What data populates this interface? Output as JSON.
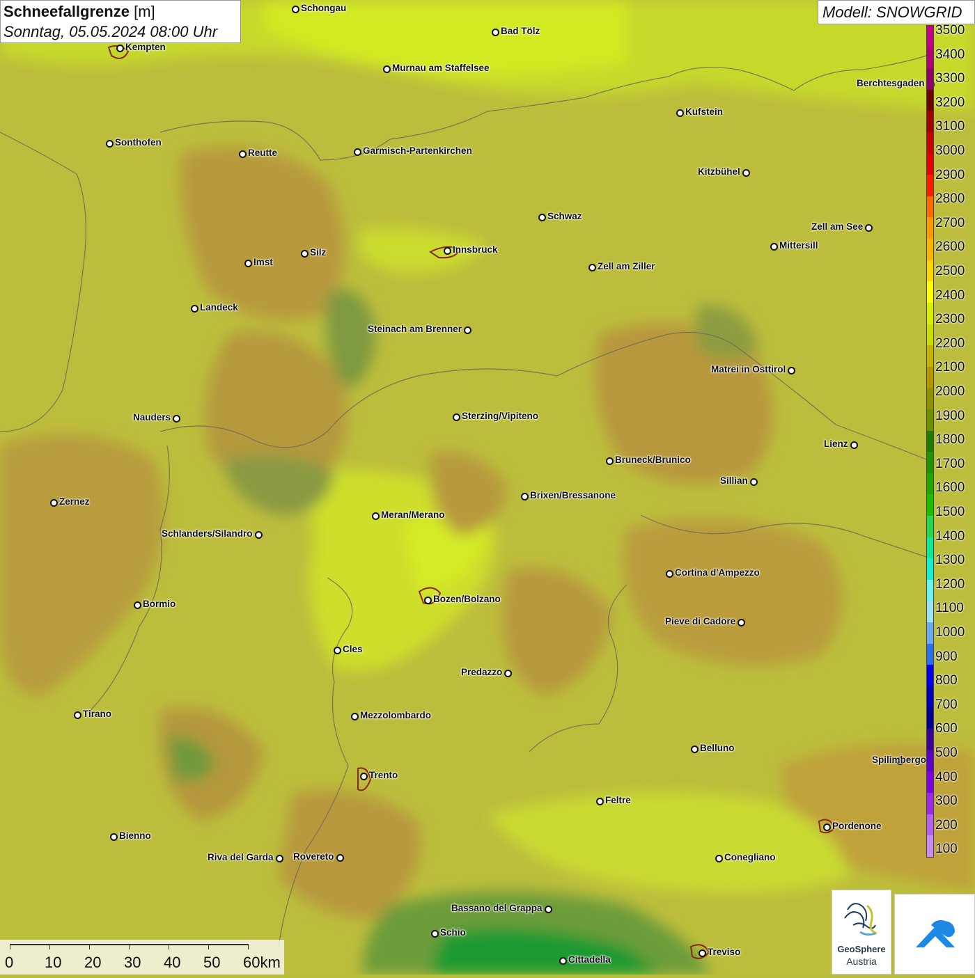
{
  "header": {
    "title_bold": "Schneefallgrenze",
    "title_unit": "[m]",
    "timestamp": "Sonntag, 05.05.2024 08:00 Uhr",
    "model": "Modell: SNOWGRID"
  },
  "legend": {
    "colors": [
      "#c4008a",
      "#b00075",
      "#8b0066",
      "#6a0000",
      "#a00000",
      "#c80000",
      "#e40000",
      "#ff1a00",
      "#ff6a00",
      "#ff9a00",
      "#ffb400",
      "#ffd600",
      "#ffff00",
      "#d8f000",
      "#c8e000",
      "#c2b400",
      "#b79500",
      "#8f9200",
      "#6e8f00",
      "#1f7a00",
      "#1e9400",
      "#20a800",
      "#18c000",
      "#24d850",
      "#12e89a",
      "#16f0d0",
      "#6af4f4",
      "#9ae4f4",
      "#6aaaf0",
      "#2a6ef0",
      "#0000e6",
      "#0000b4",
      "#00008c",
      "#3a0096",
      "#5a00c4",
      "#7a00e0",
      "#9a2ae8",
      "#b460ee",
      "#c88cf2"
    ],
    "labels": [
      "3500",
      "3400",
      "3300",
      "3200",
      "3100",
      "3000",
      "2900",
      "2800",
      "2700",
      "2600",
      "2500",
      "2400",
      "2300",
      "2200",
      "2100",
      "2000",
      "1900",
      "1800",
      "1700",
      "1600",
      "1500",
      "1400",
      "1300",
      "1200",
      "1100",
      "1000",
      "900",
      "800",
      "700",
      "600",
      "500",
      "400",
      "300",
      "200",
      "100"
    ]
  },
  "scale": {
    "labels": [
      "0",
      "10",
      "20",
      "30",
      "40",
      "50",
      "60km"
    ]
  },
  "cities": [
    {
      "name": "Schongau",
      "side": "right"
    },
    {
      "name": "Bad Tölz",
      "side": "right"
    },
    {
      "name": "Kempten",
      "side": "right"
    },
    {
      "name": "Murnau am Staffelsee",
      "side": "right"
    },
    {
      "name": "Berchtesgaden",
      "side": "left"
    },
    {
      "name": "Kufstein",
      "side": "right"
    },
    {
      "name": "Sonthofen",
      "side": "right"
    },
    {
      "name": "Reutte",
      "side": "right"
    },
    {
      "name": "Garmisch-Partenkirchen",
      "side": "right"
    },
    {
      "name": "Kitzbühel",
      "side": "left"
    },
    {
      "name": "Schwaz",
      "side": "right"
    },
    {
      "name": "Zell am See",
      "side": "left"
    },
    {
      "name": "Mittersill",
      "side": "right"
    },
    {
      "name": "Innsbruck",
      "side": "right"
    },
    {
      "name": "Imst",
      "side": "right"
    },
    {
      "name": "Silz",
      "side": "right"
    },
    {
      "name": "Zell am Ziller",
      "side": "right"
    },
    {
      "name": "Landeck",
      "side": "right"
    },
    {
      "name": "Steinach am Brenner",
      "side": "left"
    },
    {
      "name": "Matrei in Osttirol",
      "side": "left"
    },
    {
      "name": "Nauders",
      "side": "left"
    },
    {
      "name": "Sterzing/Vipiteno",
      "side": "right"
    },
    {
      "name": "Lienz",
      "side": "left"
    },
    {
      "name": "Bruneck/Brunico",
      "side": "right"
    },
    {
      "name": "Sillian",
      "side": "left"
    },
    {
      "name": "Zernez",
      "side": "right"
    },
    {
      "name": "Brixen/Bressanone",
      "side": "right"
    },
    {
      "name": "Meran/Merano",
      "side": "right"
    },
    {
      "name": "Schlanders/Silandro",
      "side": "left"
    },
    {
      "name": "Cortina d'Ampezzo",
      "side": "right"
    },
    {
      "name": "Bormio",
      "side": "right"
    },
    {
      "name": "Bozen/Bolzano",
      "side": "right"
    },
    {
      "name": "Pieve di Cadore",
      "side": "left"
    },
    {
      "name": "Cles",
      "side": "right"
    },
    {
      "name": "Predazzo",
      "side": "left"
    },
    {
      "name": "Tirano",
      "side": "right"
    },
    {
      "name": "Mezzolombardo",
      "side": "right"
    },
    {
      "name": "Belluno",
      "side": "right"
    },
    {
      "name": "Spilimbergo",
      "side": "right"
    },
    {
      "name": "Trento",
      "side": "right"
    },
    {
      "name": "Feltre",
      "side": "right"
    },
    {
      "name": "Pordenone",
      "side": "right"
    },
    {
      "name": "Bienno",
      "side": "right"
    },
    {
      "name": "Riva del Garda",
      "side": "left"
    },
    {
      "name": "Rovereto",
      "side": "left"
    },
    {
      "name": "Conegliano",
      "side": "right"
    },
    {
      "name": "Bassano del Grappa",
      "side": "left"
    },
    {
      "name": "Schio",
      "side": "right"
    },
    {
      "name": "Treviso",
      "side": "right"
    },
    {
      "name": "Cittadella",
      "side": "right"
    }
  ],
  "logos": {
    "geosphere_line1": "GeoSphere",
    "geosphere_line2": "Austria"
  }
}
